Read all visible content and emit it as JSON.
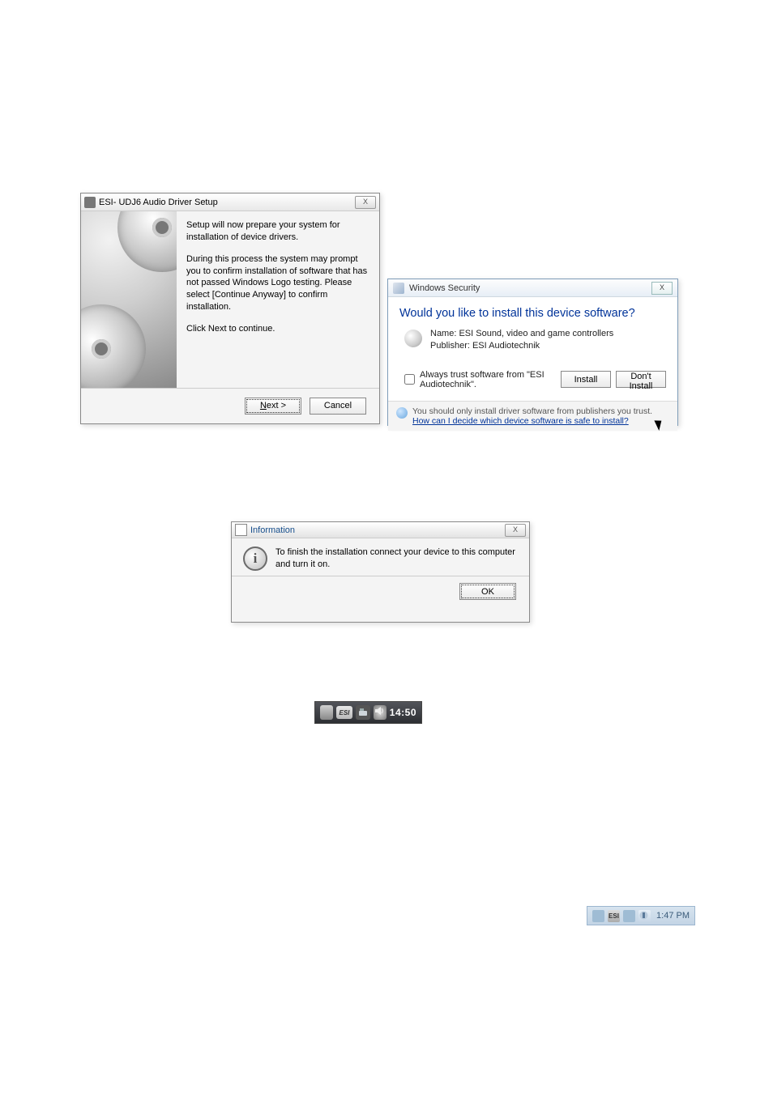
{
  "setup": {
    "title": "ESI- UDJ6 Audio Driver Setup",
    "p1": "Setup will now prepare your system for installation of device drivers.",
    "p2": "During this process the system may prompt you to confirm installation of software that has not passed Windows Logo testing. Please select [Continue Anyway] to confirm installation.",
    "p3": "Click Next to continue.",
    "next_label": "Next >",
    "next_accesskey_char": "N",
    "cancel_label": "Cancel",
    "close_label": "X"
  },
  "security": {
    "title": "Windows Security",
    "heading": "Would you like to install this device software?",
    "name_line": "Name: ESI Sound, video and game controllers",
    "publisher_line": "Publisher: ESI Audiotechnik",
    "trust_label": "Always trust software from \"ESI Audiotechnik\".",
    "install_label": "Install",
    "dont_install_label": "Don't Install",
    "footer_text": "You should only install driver software from publishers you trust.  ",
    "footer_link": "How can I decide which device software is safe to install?",
    "close_label": "X"
  },
  "info": {
    "title": "Information",
    "body": "To finish the installation connect your device to this computer and turn it on.",
    "ok_label": "OK",
    "close_label": "X"
  },
  "taskbar1": {
    "esi_label": "ESI",
    "time": "14:50"
  },
  "taskbar2": {
    "esi_label": "ESI",
    "time": "1:47 PM"
  }
}
